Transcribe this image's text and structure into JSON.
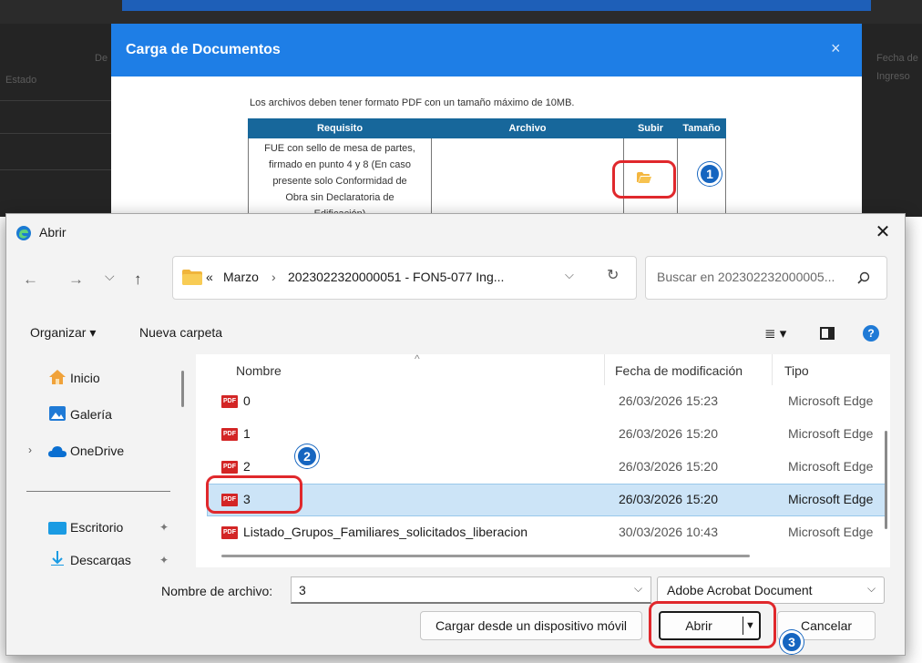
{
  "web": {
    "modal_title": "Carga de Documentos",
    "modal_close": "×",
    "info_text": "Los archivos deben tener formato PDF con un tamaño máximo de 10MB.",
    "columns": [
      "Requisito",
      "Archivo",
      "Subir",
      "Tamaño"
    ],
    "requirement": [
      "FUE con sello de mesa de partes,",
      "firmado en punto 4 y 8 (En caso",
      "presente solo Conformidad de",
      "Obra sin Declaratoria de",
      "Edificación)"
    ],
    "bg_left_1": "Estado",
    "bg_left_2": "De",
    "bg_right_1": "Fecha de",
    "bg_right_2": "Ingreso"
  },
  "callouts": [
    "1",
    "2",
    "3"
  ],
  "dialog": {
    "title": "Abrir",
    "close": "✕",
    "nav": {
      "back": "←",
      "forward": "→",
      "recent": "⌵",
      "up": "↑"
    },
    "breadcrumb": {
      "overflow": "«",
      "sep": "›",
      "parts": [
        "Marzo",
        "2023022320000051 - FON5-077 Ing..."
      ]
    },
    "search_placeholder": "Buscar en 202302232000005...",
    "toolbar": {
      "organize": "Organizar ▾",
      "new_folder": "Nueva carpeta",
      "view": "≣ ▾"
    },
    "sidebar": [
      {
        "label": "Inicio",
        "icon": "home-icon"
      },
      {
        "label": "Galería",
        "icon": "gallery-icon"
      },
      {
        "label": "OneDrive",
        "icon": "cloud-icon",
        "selected": true
      },
      {
        "label": "Escritorio",
        "icon": "desktop-icon",
        "pin": "✦"
      },
      {
        "label": "Descargas",
        "icon": "download-icon",
        "pin": "✦"
      }
    ],
    "columns": {
      "name": "Nombre",
      "date": "Fecha de modificación",
      "type": "Tipo"
    },
    "files": [
      {
        "name": "0",
        "date": "26/03/2026 15:23",
        "type": "Microsoft Edge"
      },
      {
        "name": "1",
        "date": "26/03/2026 15:20",
        "type": "Microsoft Edge"
      },
      {
        "name": "2",
        "date": "26/03/2026 15:20",
        "type": "Microsoft Edge"
      },
      {
        "name": "3",
        "date": "26/03/2026 15:20",
        "type": "Microsoft Edge",
        "selected": true
      },
      {
        "name": "Listado_Grupos_Familiares_solicitados_liberacion",
        "date": "30/03/2026 10:43",
        "type": "Microsoft Edge"
      }
    ],
    "filename_label": "Nombre de archivo:",
    "filename_value": "3",
    "filetype_value": "Adobe Acrobat Document",
    "mobile_button": "Cargar desde un dispositivo móvil",
    "open_button": "Abrir",
    "cancel_button": "Cancelar"
  },
  "colors": {
    "accent": "#1e7ee6",
    "header": "#17679b",
    "highlight": "#e0282c",
    "selection": "#cce4f7",
    "badge": "#1565c0"
  }
}
